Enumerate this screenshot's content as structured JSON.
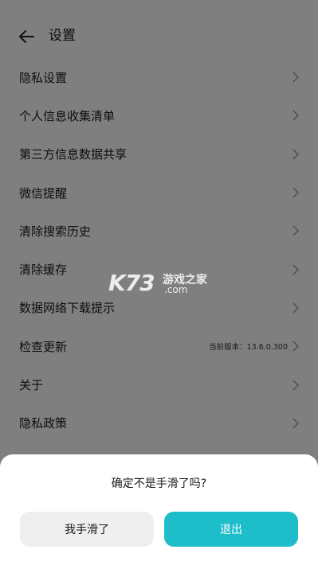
{
  "header": {
    "title": "设置",
    "back_icon": "arrow-left-icon"
  },
  "settings": {
    "items": [
      {
        "label": "隐私设置",
        "value": ""
      },
      {
        "label": "个人信息收集清单",
        "value": ""
      },
      {
        "label": "第三方信息数据共享",
        "value": ""
      },
      {
        "label": "微信提醒",
        "value": ""
      },
      {
        "label": "清除搜索历史",
        "value": ""
      },
      {
        "label": "清除缓存",
        "value": ""
      },
      {
        "label": "数据网络下载提示",
        "value": ""
      },
      {
        "label": "检查更新",
        "value": "当前版本：13.6.0.300"
      },
      {
        "label": "关于",
        "value": ""
      },
      {
        "label": "隐私政策",
        "value": ""
      }
    ],
    "chevron_icon": "chevron-right-icon"
  },
  "watermark": {
    "logo": "K73",
    "name": "游戏之家",
    "domain": ".com"
  },
  "dialog": {
    "message": "确定不是手滑了吗?",
    "cancel_label": "我手滑了",
    "exit_label": "退出"
  },
  "colors": {
    "accent": "#1dbdc9",
    "cancel_bg": "#efefef",
    "overlay": "rgba(0,0,0,0.5)"
  }
}
